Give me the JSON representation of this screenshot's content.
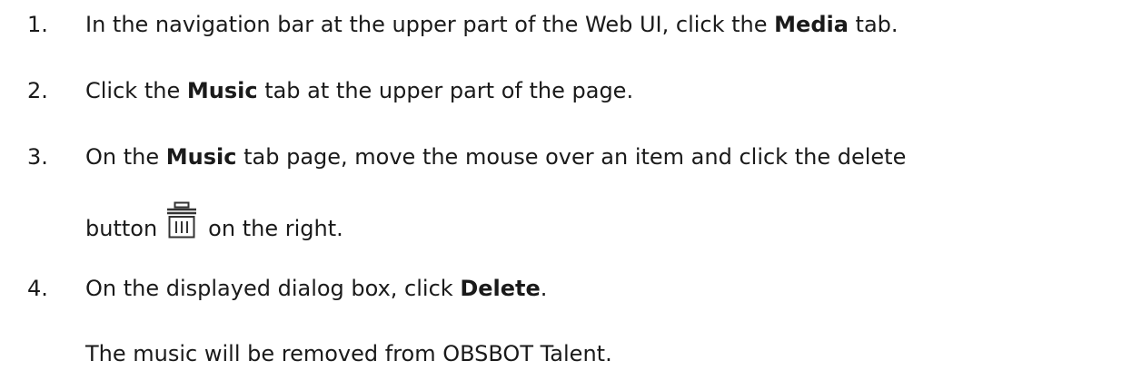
{
  "steps": [
    {
      "number": "1.",
      "line1": {
        "before": "In the navigation bar at the upper part of the Web UI, click the ",
        "bold": "Media",
        "after": " tab."
      }
    },
    {
      "number": "2.",
      "line1": {
        "before": "Click the ",
        "bold": "Music",
        "after": " tab at the upper part of the page."
      }
    },
    {
      "number": "3.",
      "line1": {
        "before": "On the ",
        "bold": "Music",
        "after": " tab page, move the mouse over an item and click the delete"
      },
      "line2": {
        "before": "button",
        "after": "on the right."
      },
      "icon": "delete-trash-icon"
    },
    {
      "number": "4.",
      "line1": {
        "before": "On the displayed dialog box, click ",
        "bold": "Delete",
        "after": "."
      },
      "result": "The music will be removed from OBSBOT Talent."
    }
  ]
}
